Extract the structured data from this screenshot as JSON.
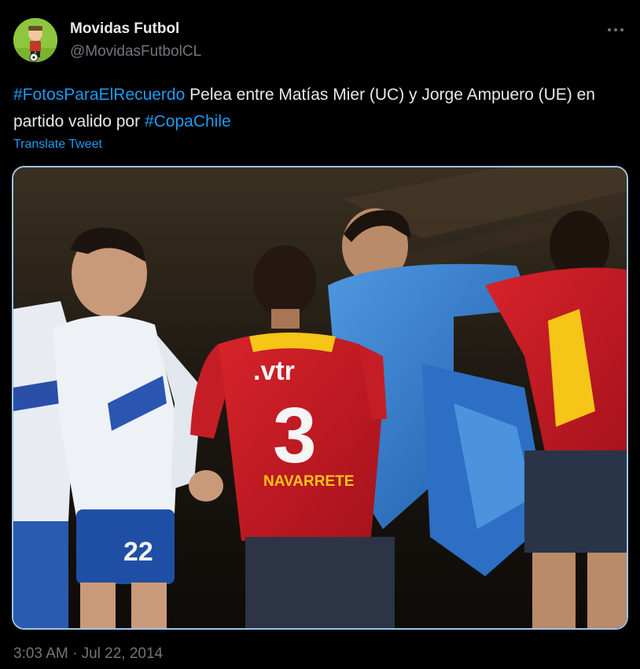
{
  "author": {
    "name": "Movidas Futbol",
    "handle": "@MovidasFutbolCL",
    "avatar_icon": "cartoon-footballer-avatar"
  },
  "more_icon": "ellipsis-icon",
  "tweet": {
    "hashtag_1": "#FotosParaElRecuerdo",
    "text_1": " Pelea entre Matías Mier (UC) y Jorge Ampuero (UE) en partido valido por ",
    "hashtag_2": "#CopaChile"
  },
  "translate_label": "Translate Tweet",
  "media": {
    "jersey_sponsor": ".vtr",
    "jersey_number": "3",
    "jersey_name": "NAVARRETE",
    "shorts_number": "22"
  },
  "timestamp": "3:03 AM · Jul 22, 2014",
  "colors": {
    "background": "#000000",
    "text": "#e7e9ea",
    "secondary_text": "#71767b",
    "link": "#1d9bf0",
    "media_border": "#9dc5e8"
  }
}
